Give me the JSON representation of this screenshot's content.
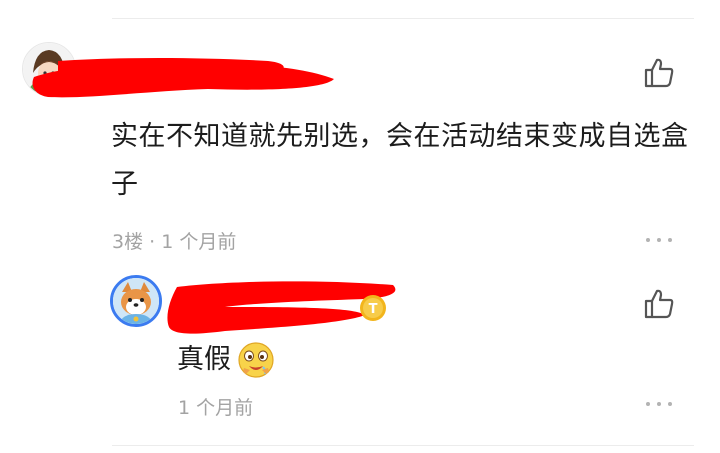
{
  "comment": {
    "text": "实在不知道就先别选，会在活动结束变成自选盒子",
    "floor": "3楼",
    "separator": " · ",
    "time": "1 个月前",
    "avatar_icon": "anime-character-avatar",
    "like_icon": "thumbs-up-icon",
    "more_icon": "more-dots-icon"
  },
  "reply": {
    "text": "真假",
    "emoji": "drooling-face-emoji",
    "time": "1 个月前",
    "avatar_icon": "shiba-dog-avatar",
    "badge_icon": "level-badge-icon",
    "badge_text": "T",
    "like_icon": "thumbs-up-icon",
    "more_icon": "more-dots-icon"
  },
  "colors": {
    "text": "#1c1c1c",
    "meta": "#a3a3a3",
    "redaction": "#ff0000",
    "avatar_ring": "#3b7bf0",
    "badge": "#f2b51c"
  }
}
